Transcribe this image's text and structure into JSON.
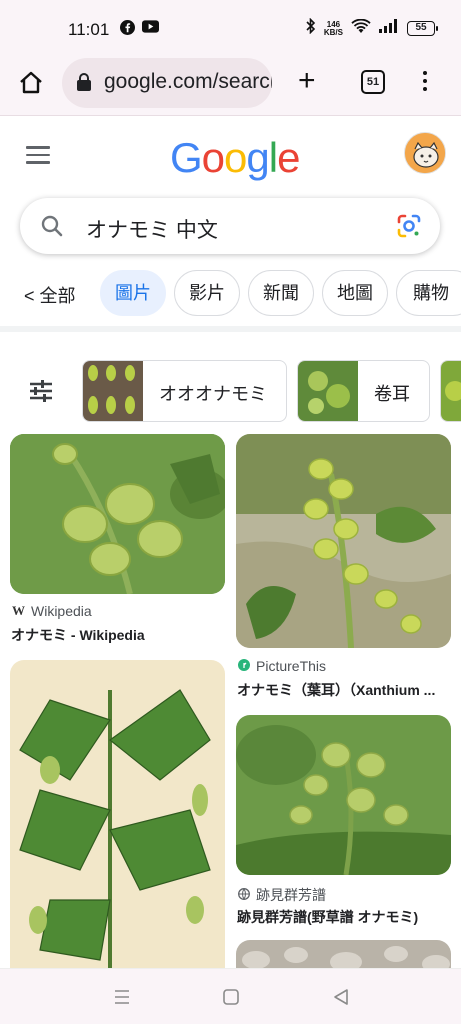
{
  "status": {
    "time": "11:01",
    "net_speed_top": "146",
    "net_speed_unit": "KB/S",
    "battery": "55"
  },
  "browser": {
    "url": "google.com/search",
    "tab_count": "51",
    "new_tab_label": "+"
  },
  "google": {
    "logo_letters": [
      "G",
      "o",
      "o",
      "g",
      "l",
      "e"
    ],
    "logo_colors": [
      "#4285F4",
      "#EA4335",
      "#FBBC05",
      "#4285F4",
      "#34A853",
      "#EA4335"
    ],
    "query": "オナモミ 中文"
  },
  "chips": {
    "back_all": "< 全部",
    "items": [
      "圖片",
      "影片",
      "新聞",
      "地圖",
      "購物"
    ],
    "active_index": 0
  },
  "related": [
    {
      "label": "オオオナモミ"
    },
    {
      "label": "卷耳"
    }
  ],
  "results": [
    {
      "source": "Wikipedia",
      "source_icon": "W",
      "title": "オナモミ - Wikipedia"
    },
    {
      "source": "PictureThis",
      "source_icon": "leaf-icon",
      "title": "オナモミ（葉耳）（Xanthium ..."
    },
    {
      "source": "跡見群芳譜",
      "source_icon": "globe-icon",
      "title": "跡見群芳譜(野草譜 オナモミ)"
    }
  ],
  "colors": {
    "accent": "#1a73e8",
    "chip_active_bg": "#e8f0fe",
    "toolbar_bg": "#faf4f8",
    "plant_green": "#7fa83a"
  }
}
